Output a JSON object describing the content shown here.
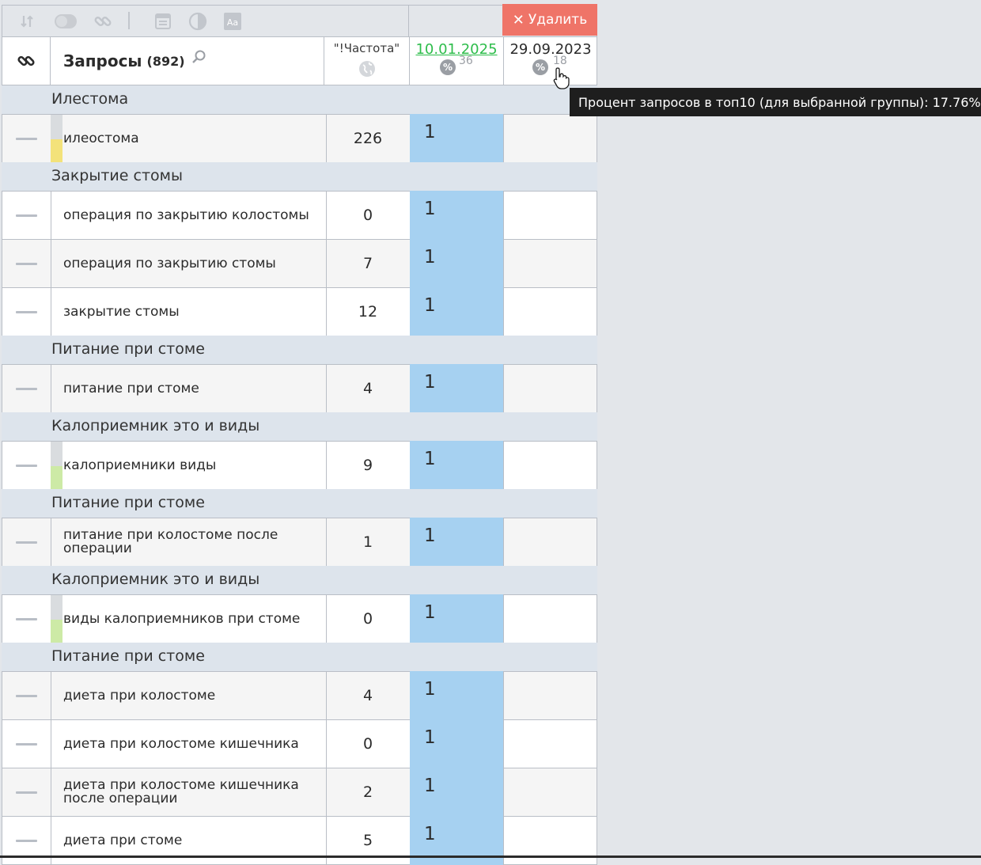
{
  "toolbar": {
    "icons": [
      "sort-icon",
      "toggle-icon",
      "link-icon",
      "window-icon",
      "contrast-icon",
      "font-icon"
    ],
    "delete_label": "Удалить"
  },
  "header": {
    "queries_title": "Запросы",
    "queries_count": "(892)",
    "frequency_label": "\"!Частота\"",
    "date1": "10.01.2025",
    "date1_pct": "36",
    "date2": "29.09.2023",
    "date2_pct": "18"
  },
  "tooltip": "Процент запросов в топ10 (для выбранной группы): 17.76%",
  "groups": [
    "Илестома",
    "Закрытие стомы",
    "Питание при стоме",
    "Калоприемник это и виды",
    "Питание при стоме",
    "Калоприемник это и виды",
    "Питание при стоме"
  ],
  "rows": [
    {
      "query": "илеостома",
      "freq": "226",
      "pos": "1"
    },
    {
      "query": "операция по закрытию колостомы",
      "freq": "0",
      "pos": "1"
    },
    {
      "query": "операция по закрытию стомы",
      "freq": "7",
      "pos": "1"
    },
    {
      "query": "закрытие стомы",
      "freq": "12",
      "pos": "1"
    },
    {
      "query": "питание при стоме",
      "freq": "4",
      "pos": "1"
    },
    {
      "query": "калоприемники виды",
      "freq": "9",
      "pos": "1"
    },
    {
      "query": "питание при колостоме после операции",
      "freq": "1",
      "pos": "1"
    },
    {
      "query": "виды калоприемников при стоме",
      "freq": "0",
      "pos": "1"
    },
    {
      "query": "диета при колостоме",
      "freq": "4",
      "pos": "1"
    },
    {
      "query": "диета при колостоме кишечника",
      "freq": "0",
      "pos": "1"
    },
    {
      "query": "диета при колостоме кишечника после операции",
      "freq": "2",
      "pos": "1"
    },
    {
      "query": "диета при стоме",
      "freq": "5",
      "pos": "1"
    }
  ],
  "colors": {
    "accent_green": "#2ebd4b",
    "delete_red": "#ef7468",
    "position_blue": "#a6d1f1",
    "bar_yellow": "#f3e27a",
    "bar_green": "#cdeaa6"
  }
}
